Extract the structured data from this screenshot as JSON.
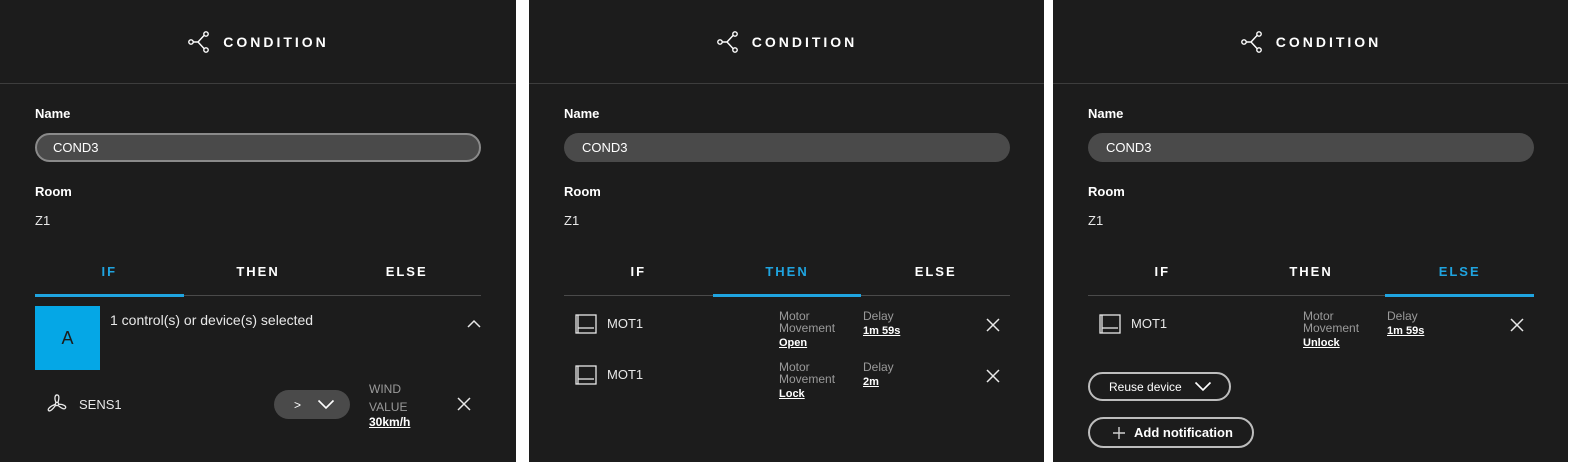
{
  "header_title": "CONDITION",
  "labels": {
    "name": "Name",
    "room": "Room"
  },
  "condition": {
    "name": "COND3",
    "room": "Z1"
  },
  "tabs": [
    "IF",
    "THEN",
    "ELSE"
  ],
  "panels": {
    "if": {
      "active_tab": "IF",
      "group_letter": "A",
      "group_text": "1 control(s) or device(s) selected",
      "sensor": {
        "icon": "fan-icon",
        "name": "SENS1",
        "operator": ">",
        "type_label_1": "WIND",
        "type_label_2": "VALUE",
        "value": "30km/h"
      }
    },
    "then": {
      "active_tab": "THEN",
      "actions": [
        {
          "device": "MOT1",
          "icon": "blind-icon",
          "label_1": "Motor",
          "label_2": "Movement",
          "movement": "Open",
          "delay_label": "Delay",
          "delay": "1m 59s"
        },
        {
          "device": "MOT1",
          "icon": "blind-icon",
          "label_1": "Motor",
          "label_2": "Movement",
          "movement": "Lock",
          "delay_label": "Delay",
          "delay": "2m"
        }
      ]
    },
    "else": {
      "active_tab": "ELSE",
      "actions": [
        {
          "device": "MOT1",
          "icon": "blind-icon",
          "label_1": "Motor",
          "label_2": "Movement",
          "movement": "Unlock",
          "delay_label": "Delay",
          "delay": "1m 59s"
        }
      ],
      "reuse_button": "Reuse device",
      "add_notification_button": "Add notification"
    }
  },
  "colors": {
    "accent": "#1fa4e0",
    "panel_bg": "#1c1c1c",
    "group_tile": "#05a7e6",
    "input_bg": "#4a4a4a"
  }
}
